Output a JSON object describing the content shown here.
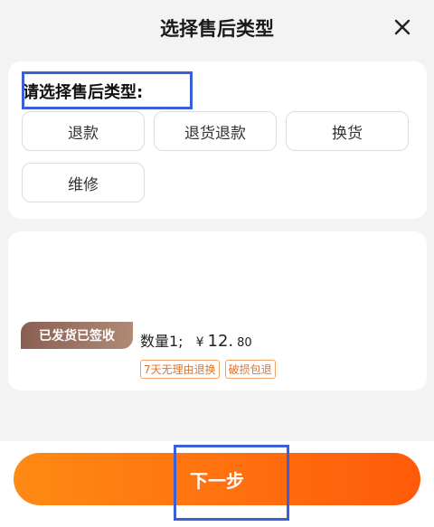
{
  "header": {
    "title": "选择售后类型",
    "close_icon": "close-icon"
  },
  "service_type": {
    "label": "请选择售后类型:",
    "options": [
      "退款",
      "退货退款",
      "换货",
      "维修"
    ]
  },
  "product": {
    "badge": "已发货已签收",
    "quantity": "数量1;",
    "price_symbol": "¥",
    "price_int": "12.",
    "price_dec": "80",
    "tags": [
      "7天无理由退换",
      "破损包退"
    ]
  },
  "footer": {
    "next_label": "下一步"
  },
  "colors": {
    "accent_start": "#ff8a14",
    "accent_end": "#ff5a0a",
    "highlight_box": "#3a5fd9"
  }
}
